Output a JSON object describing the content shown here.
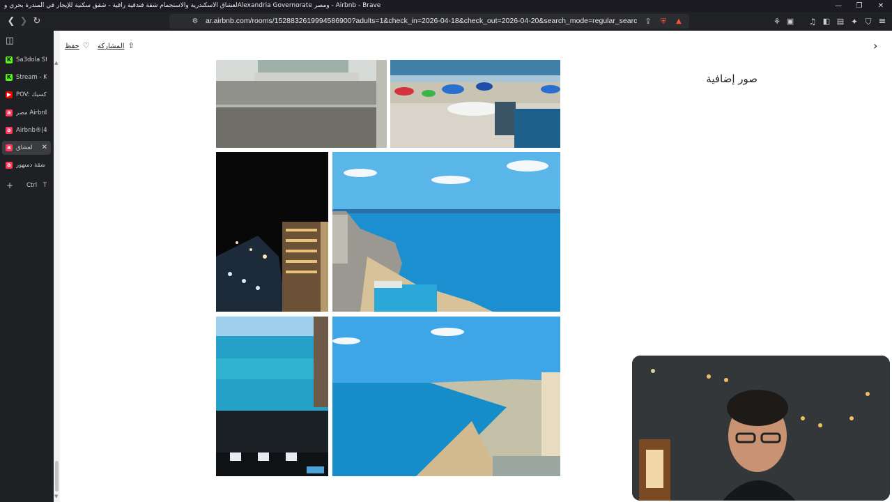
{
  "window": {
    "title": "لعشاق الاسكندرية والاستجمام شقة فندقية راقية - شقق سكنية للإيجار في المندرة بحري وAlexandria Governorate ومصر - Airbnb - Brave",
    "minimize_glyph": "—",
    "restore_glyph": "❐",
    "close_glyph": "✕"
  },
  "toolbar": {
    "url": "ar.airbnb.com/rooms/1528832619994586900?adults=1&check_in=2026-04-18&check_out=2026-04-20&search_mode=regular_search&amenities%5..."
  },
  "tabs": [
    {
      "title": "Sa3dola St",
      "favicon": "kick-icon",
      "color": "#53fc18",
      "glyph": "K",
      "active": false
    },
    {
      "title": "Stream - Ki",
      "favicon": "kick-icon",
      "color": "#53fc18",
      "glyph": "K",
      "active": false
    },
    {
      "title": "POV: كسيك",
      "favicon": "youtube-icon",
      "color": "#ff0000",
      "glyph": "▶",
      "active": false
    },
    {
      "title": "مصر Airbnb",
      "favicon": "airbnb-icon",
      "color": "#ff385c",
      "glyph": "a",
      "active": false
    },
    {
      "title": "Airbnb®|4",
      "favicon": "airbnb-icon",
      "color": "#ff385c",
      "glyph": "a",
      "active": false
    },
    {
      "title": "لعشاق",
      "favicon": "airbnb-icon",
      "color": "#ff385c",
      "glyph": "a",
      "active": true
    },
    {
      "title": "شقة دمنهور",
      "favicon": "airbnb-icon",
      "color": "#ff385c",
      "glyph": "a",
      "active": false
    }
  ],
  "new_tab": {
    "plus": "+",
    "shortcut": "Ctrl T"
  },
  "page": {
    "save_label": "حفظ",
    "share_label": "المشاركة",
    "gallery_title": "صور إضافية"
  },
  "photos": [
    {
      "name": "photo-balcony-view",
      "description": "balcony-railing"
    },
    {
      "name": "photo-beach-chairs",
      "description": "beach-umbrellas"
    },
    {
      "name": "photo-night-corniche",
      "description": "night-city"
    },
    {
      "name": "photo-sea-coast",
      "description": "sea-view"
    },
    {
      "name": "photo-sea-balcony",
      "description": "sea-from-balcony"
    },
    {
      "name": "photo-bay-view",
      "description": "bay-beach"
    }
  ],
  "colors": {
    "accent": "#ff385c",
    "sea": "#1c8fd0",
    "sky": "#5ab6e8"
  }
}
